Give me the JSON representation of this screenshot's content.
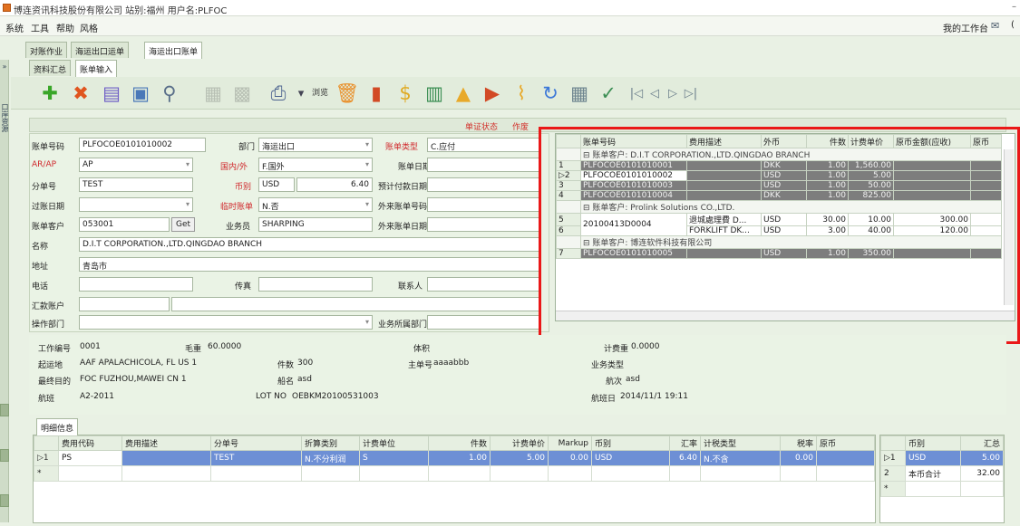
{
  "window": {
    "title": "博连资讯科技股份有限公司 站别:福州  用户名:PLFOC"
  },
  "menu": {
    "items": [
      "系统",
      "工具",
      "帮助",
      "风格"
    ],
    "workspace": "我的工作台"
  },
  "tabs_top": [
    "对账作业",
    "海运出口运单",
    "海运出口账单"
  ],
  "tabs_sub": [
    "资料汇总",
    "账单输入"
  ],
  "side_strip": {
    "label": "口岸资源"
  },
  "toolbar": {
    "browse_label": "浏览",
    "icons": [
      "add-icon",
      "delete-icon",
      "edit-icon",
      "window-icon",
      "search-icon",
      "save-icon",
      "save-disabled-icon",
      "print-icon",
      "browse-icon",
      "trash-icon",
      "chart-icon",
      "money-icon",
      "doc-icon",
      "upload-icon",
      "export-icon",
      "attach-icon",
      "refresh-icon",
      "table-icon",
      "audit-icon",
      "first-icon",
      "prev-icon",
      "next-icon",
      "last-icon"
    ],
    "nav": [
      "|◁",
      "◁",
      "▷",
      "▷|"
    ]
  },
  "status": {
    "label": "单证状态",
    "value": "作废"
  },
  "form": {
    "bill_no_label": "账单号码",
    "bill_no": "PLFOCOE0101010002",
    "dept_label": "部门",
    "dept": "海运出口",
    "bill_type_label": "账单类型",
    "bill_type": "C.应付",
    "arap_label": "AR/AP",
    "arap": "AP",
    "domestic_label": "国内/外",
    "domestic": "F.国外",
    "bill_date_label": "账单日期",
    "bill_date": "",
    "sub_no_label": "分单号",
    "sub_no": "TEST",
    "currency_label": "币别",
    "currency": "USD",
    "rate": "6.40",
    "pay_date_label": "预计付款日期",
    "pay_date": "",
    "post_date_label": "过账日期",
    "post_date": "",
    "temp_label": "临时账单",
    "temp": "N.否",
    "ext_no_label": "外来账单号码",
    "ext_no": "",
    "customer_label": "账单客户",
    "customer_code": "053001",
    "get_label": "Get",
    "salesman_label": "业务员",
    "salesman": "SHARPING",
    "ext_date_label": "外来账单日期",
    "ext_date": "",
    "name_label": "名称",
    "name": "D.I.T CORPORATION.,LTD.QINGDAO BRANCH",
    "addr_label": "地址",
    "addr": "青岛市",
    "phone_label": "电话",
    "fax_label": "传真",
    "contact_label": "联系人",
    "acct_label": "汇款账户",
    "op_dept_label": "操作部门",
    "biz_dept_label": "业务所属部门"
  },
  "bill_grid": {
    "headers": [
      "账单号码",
      "费用描述",
      "外币",
      "件数",
      "计费单价",
      "原币金额(应收)",
      "原币"
    ],
    "groups": [
      {
        "label": "账单客户: D.I.T CORPORATION.,LTD.QINGDAO BRANCH",
        "rows": [
          {
            "rn": "1",
            "no": "PLFOCOE0101010001",
            "desc": "",
            "cur": "DKK",
            "qty": "1.00",
            "price": "1,560.00",
            "amt": ""
          },
          {
            "rn": "▷2",
            "no": "PLFOCOE0101010002",
            "desc": "",
            "cur": "USD",
            "qty": "1.00",
            "price": "5.00",
            "amt": ""
          },
          {
            "rn": "3",
            "no": "PLFOCOE0101010003",
            "desc": "",
            "cur": "USD",
            "qty": "1.00",
            "price": "50.00",
            "amt": ""
          },
          {
            "rn": "4",
            "no": "PLFOCOE0101010004",
            "desc": "",
            "cur": "DKK",
            "qty": "1.00",
            "price": "825.00",
            "amt": ""
          }
        ]
      },
      {
        "label": "账单客户: Prolink Solutions CO.,LTD.",
        "rows": [
          {
            "rn": "5",
            "no": "20100413D0004",
            "desc": "退城處理費 D...",
            "cur": "USD",
            "qty": "30.00",
            "price": "10.00",
            "amt": "300.00"
          },
          {
            "rn": "6",
            "no": "",
            "desc": "FORKLIFT DK...",
            "cur": "USD",
            "qty": "3.00",
            "price": "40.00",
            "amt": "120.00"
          }
        ]
      },
      {
        "label": "账单客户: 博连软件科技有限公司",
        "rows": [
          {
            "rn": "7",
            "no": "PLFOCOE0101010005",
            "desc": "",
            "cur": "USD",
            "qty": "1.00",
            "price": "350.00",
            "amt": ""
          }
        ]
      }
    ]
  },
  "info": {
    "job_no_label": "工作编号",
    "job_no": "0001",
    "gross_label": "毛重",
    "gross": "60.0000",
    "volume_label": "体积",
    "pol_label": "起运地",
    "pol": "AAF APALACHICOLA, FL  US 1",
    "pkgs_label": "件数",
    "pkgs": "300",
    "mbl_label": "主单号",
    "mbl": "aaaabbb",
    "biz_type_label": "业务类型",
    "dest_label": "最终目的",
    "dest": "FOC FUZHOU,MAWEI    CN 1",
    "vessel_label": "船名",
    "vessel": "asd",
    "voyage_label": "航次",
    "voyage": "asd",
    "flight_label": "航班",
    "flight": "A2-2011",
    "lot_label": "LOT NO",
    "lot": "OEBKM20100531003",
    "sail_date_label": "航班日",
    "sail_date": "2014/11/1 19:11",
    "partial_label": "计费重",
    "partial": "0.0000"
  },
  "detail": {
    "tab": "明细信息",
    "headers": [
      "费用代码",
      "费用描述",
      "分单号",
      "折算类别",
      "计费单位",
      "件数",
      "计费单价",
      "Markup",
      "币别",
      "汇率",
      "计税类型",
      "税率",
      "原币"
    ],
    "row": {
      "rn": "▷1",
      "code": "PS",
      "desc": "",
      "sub": "TEST",
      "conv": "N.不分利润",
      "unit": "S",
      "qty": "1.00",
      "price": "5.00",
      "markup": "0.00",
      "cur": "USD",
      "rate": "6.40",
      "tax_type": "N.不含",
      "tax_rate": "0.00"
    },
    "new_row_marker": "*"
  },
  "summary": {
    "headers": [
      "币别",
      "汇总"
    ],
    "rows": [
      {
        "rn": "▷1",
        "cur": "USD",
        "total": "5.00"
      },
      {
        "rn": "2",
        "cur": "本币合计",
        "total": "32.00"
      }
    ],
    "new_row_marker": "*"
  },
  "colors": {
    "accent_red": "#ea1818",
    "selection_blue": "#6d8fd5",
    "header_green": "#e6efe1"
  }
}
